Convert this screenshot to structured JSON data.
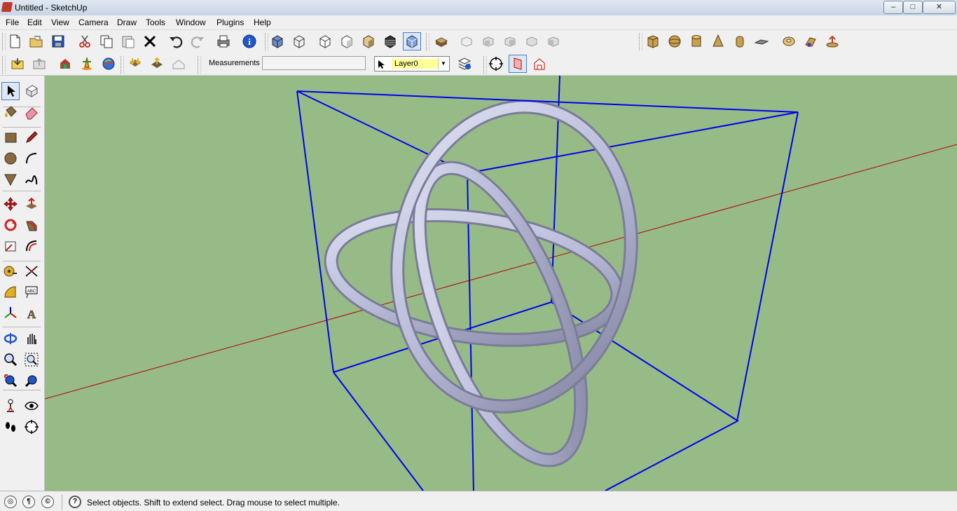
{
  "window": {
    "title": "Untitled - SketchUp",
    "min_glyph": "–",
    "max_glyph": "□",
    "close_glyph": "✕"
  },
  "menu": [
    "File",
    "Edit",
    "View",
    "Camera",
    "Draw",
    "Tools",
    "Window",
    "Plugins",
    "Help"
  ],
  "toolbar": {
    "measurements_label": "Measurements",
    "measurements_value": "",
    "layer_value": "Layer0",
    "layer_dropdown_glyph": "▼"
  },
  "icons": {
    "row1": [
      "new-file-icon",
      "open-folder-icon",
      "save-icon",
      "cut-icon",
      "copy-icon",
      "paste-icon",
      "erase-x-icon",
      "undo-icon",
      "redo-icon",
      "print-icon",
      "model-info-icon",
      "xray-icon",
      "wireframe-icon",
      "hidden-line-icon",
      "shaded-icon",
      "shaded-texture-icon",
      "monochrome-icon",
      "xray-box-icon",
      "iso-view-icon",
      "top-view-icon",
      "front-view-icon",
      "right-view-icon",
      "back-view-icon",
      "left-view-icon",
      "box-icon",
      "sphere-icon",
      "cylinder-icon",
      "cone-icon",
      "tube-icon",
      "plane-icon",
      "torus-icon",
      "helix-icon",
      "push-icon"
    ],
    "row2": [
      "get-models-icon",
      "share-model-icon",
      "share-component-icon",
      "place-model-icon",
      "google-earth-icon",
      "get-current-view-icon",
      "toggle-terrain-icon",
      "preview-earth-icon",
      "layer-manager-icon",
      "orbit-section-icon",
      "section-plane-icon",
      "section-display-icon"
    ],
    "left": [
      "select-arrow-icon",
      "make-component-icon",
      "paint-bucket-icon",
      "eraser-icon",
      "rectangle-icon",
      "pencil-icon",
      "circle-icon",
      "arc-icon",
      "polygon-icon",
      "freehand-icon",
      "move-icon",
      "push-pull-icon",
      "rotate-icon",
      "follow-me-icon",
      "scale-icon",
      "offset-icon",
      "tape-measure-icon",
      "dimension-icon",
      "protractor-icon",
      "text-icon",
      "axes-icon",
      "3d-text-icon",
      "orbit-icon",
      "pan-icon",
      "zoom-icon",
      "zoom-window-icon",
      "zoom-extents-icon",
      "previous-view-icon",
      "position-camera-icon",
      "look-around-icon",
      "walk-icon",
      "section-icon"
    ]
  },
  "colors": {
    "viewport_bg": "#97bb87",
    "bounding_box": "#0000ee",
    "red_axis": "#c00000",
    "tube_fill": "#b9bcd9",
    "tube_shade": "#8a8ca8"
  },
  "status": {
    "icons": [
      "geo-location-icon",
      "credits-icon",
      "user-icon"
    ],
    "help_glyph": "?",
    "text": "Select objects. Shift to extend select. Drag mouse to select multiple."
  }
}
